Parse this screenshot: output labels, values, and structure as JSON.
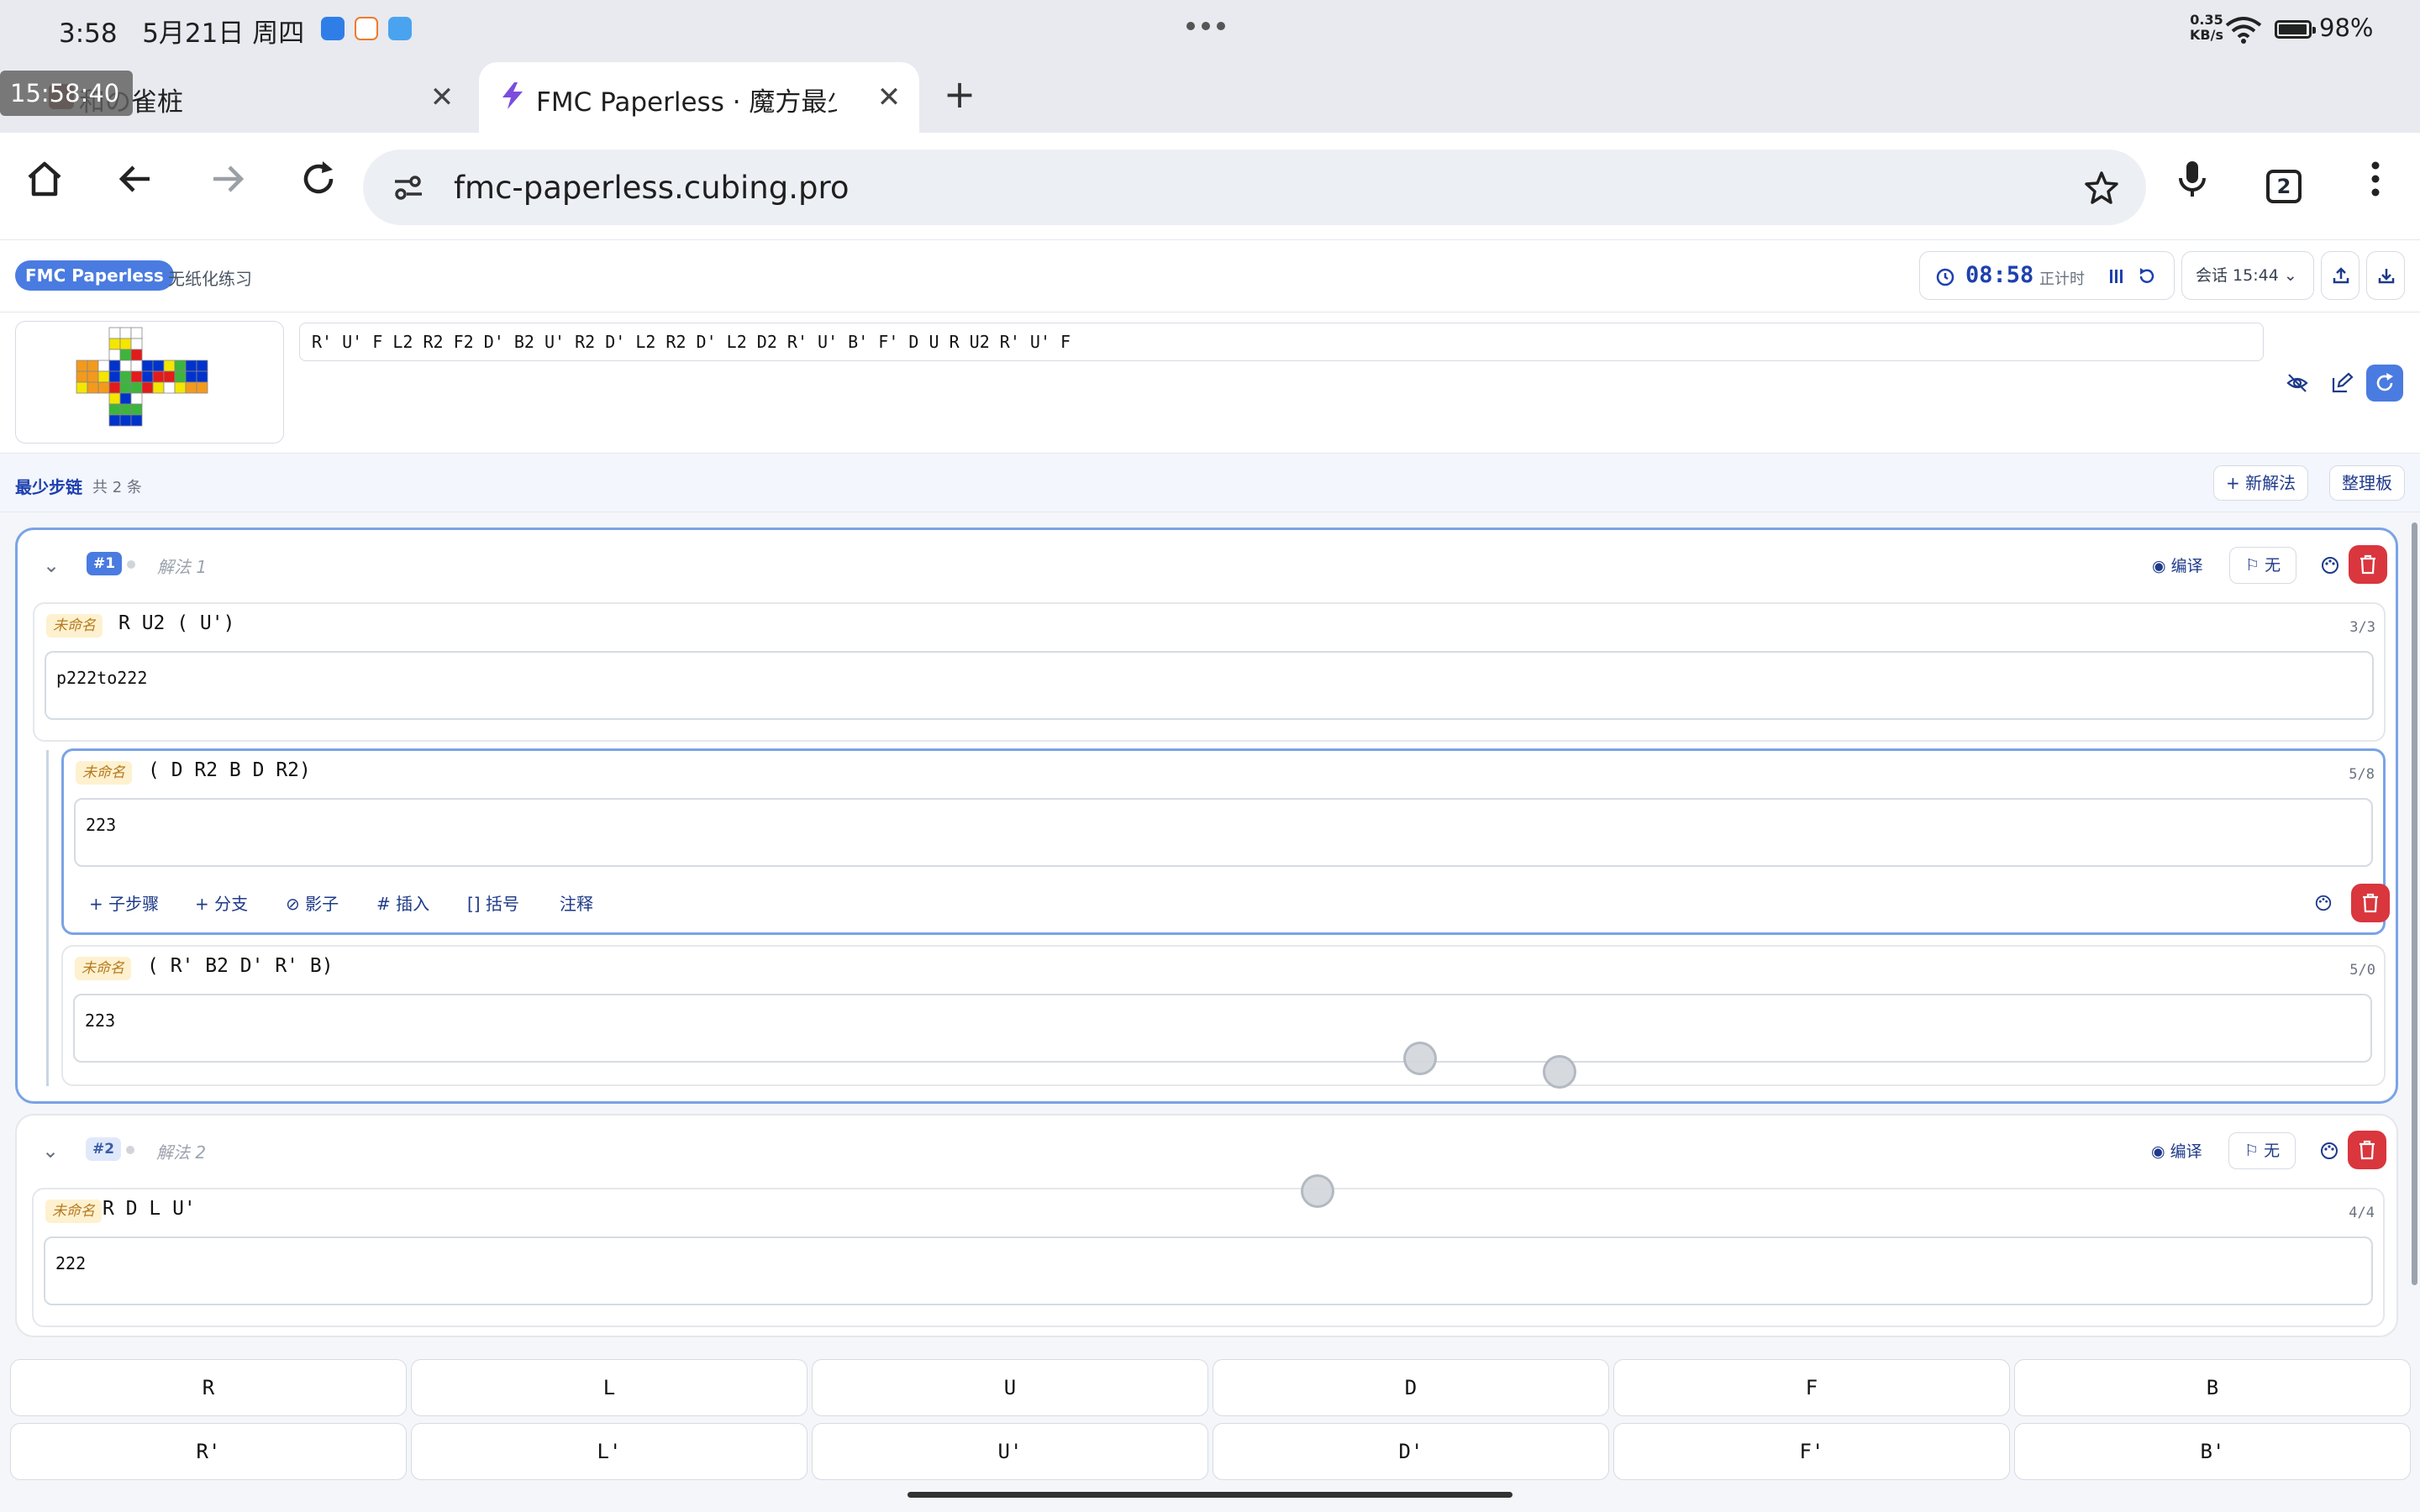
{
  "status_bar": {
    "time": "3:58",
    "date": "5月21日 周四",
    "net_speed_value": "0.35",
    "net_speed_unit": "KB/s",
    "battery": "98%",
    "app_icons": [
      "app-blue-icon",
      "app-red-icon",
      "cloud-icon"
    ]
  },
  "overlay_clock": "15:58:40",
  "tabs": [
    {
      "title": "和の雀桩",
      "favicon": "mahjong-favicon",
      "active": false
    },
    {
      "title": "FMC Paperless · 魔方最少步",
      "favicon": "lightning-favicon",
      "active": true
    }
  ],
  "toolbar": {
    "url": "fmc-paperless.cubing.pro",
    "tab_count": "2"
  },
  "app_header": {
    "brand": "FMC Paperless",
    "subtitle": "无纸化练习",
    "timer_value": "08:58",
    "timer_label": "正计时",
    "session_label": "会话 15:44"
  },
  "scramble": "R' U' F L2 R2 F2 D' B2 U' R2 D' L2 R2 D' L2 D2 R' U' B' F' D U R U2 R' U' F",
  "cube_net": {
    "U": [
      "w",
      "w",
      "w",
      "y",
      "y",
      "w",
      "w",
      "g",
      "r"
    ],
    "L": [
      "o",
      "o",
      "w",
      "o",
      "o",
      "y",
      "y",
      "o",
      "o"
    ],
    "F": [
      "b",
      "w",
      "w",
      "b",
      "g",
      "r",
      "r",
      "g",
      "g"
    ],
    "R": [
      "b",
      "b",
      "y",
      "b",
      "r",
      "r",
      "r",
      "y",
      "w"
    ],
    "B": [
      "g",
      "b",
      "b",
      "g",
      "b",
      "b",
      "y",
      "o",
      "o"
    ],
    "D": [
      "y",
      "b",
      "w",
      "g",
      "g",
      "g",
      "b",
      "b",
      "b"
    ]
  },
  "chain": {
    "title": "最少步链",
    "count": "共 2 条",
    "new_button": "+ 新解法",
    "board_button": "整理板"
  },
  "solutions": [
    {
      "badge": "#1",
      "name": "解法 1",
      "translate_label": "编译",
      "flag_label": "无",
      "steps": [
        {
          "tag": "未命名",
          "moves": "R U2 ( U')",
          "count": "3/3",
          "note": "p222to222"
        },
        {
          "tag": "未命名",
          "moves": "( D R2 B D R2)",
          "count": "5/8",
          "note": "223",
          "actions": [
            "+ 子步骤",
            "+ 分支",
            "⊘ 影子",
            "# 插入",
            "[] 括号",
            "注释"
          ]
        },
        {
          "tag": "未命名",
          "moves": "( R' B2 D' R' B)",
          "count": "5/0",
          "note": "223"
        }
      ]
    },
    {
      "badge": "#2",
      "name": "解法 2",
      "translate_label": "编译",
      "flag_label": "无",
      "steps": [
        {
          "tag": "未命名",
          "moves": "R D L U'",
          "count": "4/4",
          "note": "222"
        }
      ]
    }
  ],
  "keypad": {
    "row1": [
      "R",
      "L",
      "U",
      "D",
      "F",
      "B"
    ],
    "row2": [
      "R'",
      "L'",
      "U'",
      "D'",
      "F'",
      "B'"
    ]
  },
  "colors": {
    "accent": "#4a7be0",
    "danger": "#d9363e",
    "active_border": "#7aa3e6",
    "tag_bg": "#fdf1cf"
  }
}
